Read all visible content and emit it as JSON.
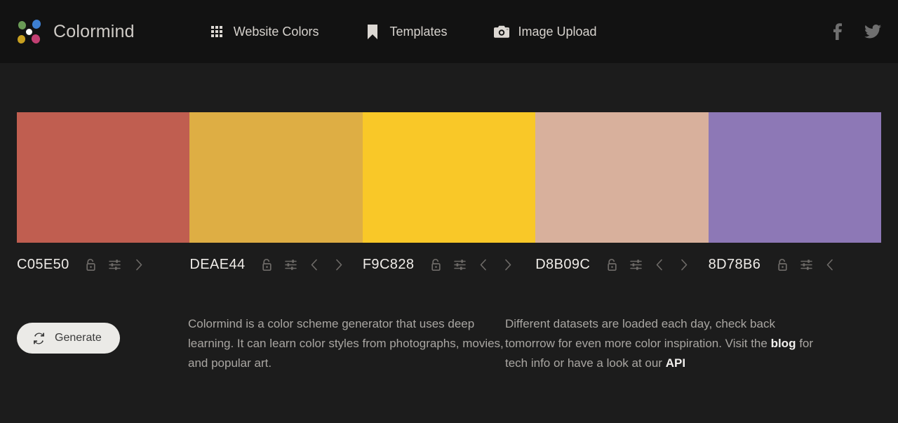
{
  "header": {
    "brand": "Colormind",
    "logo_icon": "colormind-dots-logo",
    "logo_dots": [
      {
        "name": "green",
        "color": "#6a9b56"
      },
      {
        "name": "blue",
        "color": "#3d7fd1"
      },
      {
        "name": "yellow",
        "color": "#c8a020"
      },
      {
        "name": "pink",
        "color": "#c23f72"
      },
      {
        "name": "white",
        "color": "#fdfdfd"
      }
    ],
    "nav": [
      {
        "label": "Website Colors",
        "icon": "grid-icon"
      },
      {
        "label": "Templates",
        "icon": "bookmark-icon"
      },
      {
        "label": "Image Upload",
        "icon": "camera-icon"
      }
    ],
    "social": [
      {
        "name": "facebook-icon",
        "label": "f"
      },
      {
        "name": "twitter-icon",
        "label": "twitter"
      }
    ]
  },
  "palette": {
    "swatches": [
      {
        "hex": "C05E50",
        "color": "#C05E50",
        "lock_state": "unlocked",
        "controls": [
          "lock",
          "adjust",
          "next"
        ]
      },
      {
        "hex": "DEAE44",
        "color": "#DEAE44",
        "lock_state": "unlocked",
        "controls": [
          "lock",
          "adjust",
          "prev",
          "next"
        ]
      },
      {
        "hex": "F9C828",
        "color": "#F9C828",
        "lock_state": "unlocked",
        "controls": [
          "lock",
          "adjust",
          "prev",
          "next"
        ]
      },
      {
        "hex": "D8B09C",
        "color": "#D8B09C",
        "lock_state": "unlocked",
        "controls": [
          "lock",
          "adjust",
          "prev",
          "next"
        ]
      },
      {
        "hex": "8D78B6",
        "color": "#8D78B6",
        "lock_state": "unlocked",
        "controls": [
          "lock",
          "adjust",
          "prev"
        ]
      }
    ]
  },
  "footer": {
    "generate_label": "Generate",
    "generate_icon": "refresh-icon",
    "blurb_left": "Colormind is a color scheme generator that uses deep learning. It can learn color styles from photographs, movies, and popular art.",
    "blurb_right_part1": "Different datasets are loaded each day, check back tomorrow for even more color inspiration. Visit the ",
    "blurb_right_link1": "blog",
    "blurb_right_part2": " for tech info or have a look at our ",
    "blurb_right_link2": "API"
  },
  "theme": {
    "header_bg": "#121212",
    "body_bg": "#1c1c1c",
    "text": "#a9a6a2",
    "bright_text": "#efece8",
    "button_bg": "#ebeae7"
  }
}
